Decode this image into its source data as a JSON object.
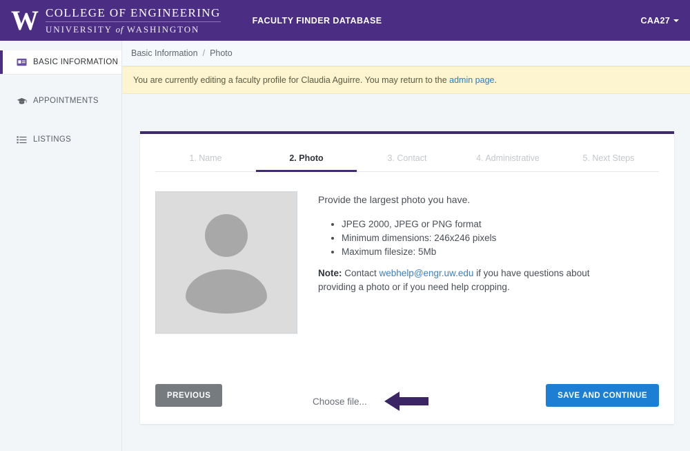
{
  "header": {
    "logo_w": "W",
    "logo_line1": "COLLEGE OF ENGINEERING",
    "logo_line2_pre": "UNIVERSITY",
    "logo_line2_of": "of",
    "logo_line2_post": "WASHINGTON",
    "app_title": "FACULTY FINDER DATABASE",
    "user": "CAA27",
    "background_color": "#4b2e83"
  },
  "sidebar": {
    "items": [
      {
        "label": "BASIC INFORMATION",
        "icon": "id-card-icon",
        "active": true
      },
      {
        "label": "APPOINTMENTS",
        "icon": "graduation-cap-icon",
        "active": false
      },
      {
        "label": "LISTINGS",
        "icon": "list-icon",
        "active": false
      }
    ]
  },
  "breadcrumb": {
    "parent": "Basic Information",
    "separator": "/",
    "current": "Photo"
  },
  "alert": {
    "text_before": "You are currently editing a faculty profile for Claudia Aguirre. You may return to the",
    "link": "admin page",
    "text_after": ".",
    "background_color": "#fcf5cf",
    "link_color": "#2b7bc4"
  },
  "wizard": {
    "steps": [
      {
        "label": "1. Name",
        "active": false
      },
      {
        "label": "2. Photo",
        "active": true
      },
      {
        "label": "3. Contact",
        "active": false
      },
      {
        "label": "4. Administrative",
        "active": false
      },
      {
        "label": "5. Next Steps",
        "active": false
      }
    ],
    "accent_color": "#3f2a6e"
  },
  "photo_panel": {
    "placeholder_alt": "photo-placeholder",
    "lead": "Provide the largest photo you have.",
    "requirements": [
      "JPEG 2000, JPEG or PNG format",
      "Minimum dimensions: 246x246 pixels",
      "Maximum filesize: 5Mb"
    ],
    "note_label": "Note:",
    "note_before": " Contact ",
    "note_email": "webhelp@engr.uw.edu",
    "note_after": " if you have questions about providing a photo or if you need help cropping.",
    "choose_file": "Choose file...",
    "annotation_arrow_color": "#3b2565"
  },
  "buttons": {
    "previous": "PREVIOUS",
    "save_and_continue": "SAVE AND CONTINUE",
    "previous_color": "#767b80",
    "save_color": "#1d7fd4"
  }
}
